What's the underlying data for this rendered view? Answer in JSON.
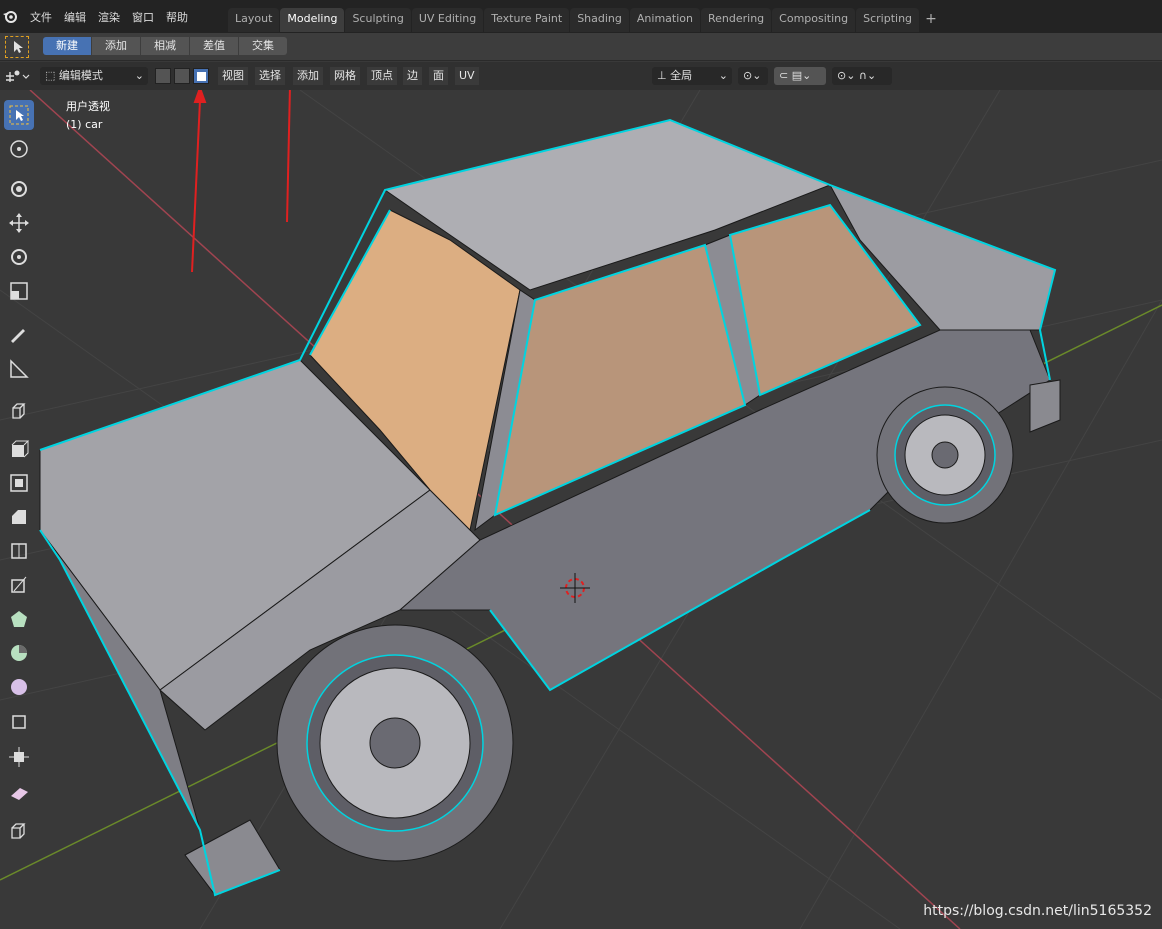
{
  "menu": [
    "文件",
    "编辑",
    "渲染",
    "窗口",
    "帮助"
  ],
  "workspace_tabs": [
    {
      "label": "Layout",
      "active": false
    },
    {
      "label": "Modeling",
      "active": true
    },
    {
      "label": "Sculpting",
      "active": false
    },
    {
      "label": "UV Editing",
      "active": false
    },
    {
      "label": "Texture Paint",
      "active": false
    },
    {
      "label": "Shading",
      "active": false
    },
    {
      "label": "Animation",
      "active": false
    },
    {
      "label": "Rendering",
      "active": false
    },
    {
      "label": "Compositing",
      "active": false
    },
    {
      "label": "Scripting",
      "active": false
    }
  ],
  "selection_modes": [
    "新建",
    "添加",
    "相减",
    "差值",
    "交集"
  ],
  "header": {
    "mode": "编辑模式",
    "menus": [
      "视图",
      "选择",
      "添加",
      "网格",
      "顶点",
      "边",
      "面",
      "UV"
    ],
    "orientation": "全局"
  },
  "viewport": {
    "view_name": "用户透视",
    "object_name": "(1) car"
  },
  "watermark": "https://blog.csdn.net/lin5165352",
  "colors": {
    "accent": "#4772b3",
    "selected_edge": "#00d4e0",
    "face_selected": "#d9a373",
    "annotation_arrow": "#e02020"
  }
}
